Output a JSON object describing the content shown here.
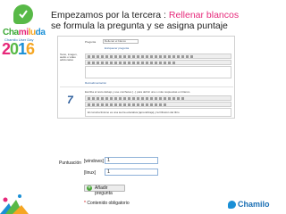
{
  "heading": {
    "prefix": "Empezamos por la tercera : ",
    "highlight": "Rellenar blancos",
    "line2": "se formula la pregunta y se asigna puntaje"
  },
  "brand": {
    "logo_parts": [
      "Cha",
      "mi",
      "lu",
      "da"
    ],
    "subtitle": "Chamilo User Day",
    "year_parts": [
      "2",
      "0",
      "1",
      "6"
    ]
  },
  "shot1": {
    "pregunta_label": "Pregunta",
    "pregunta_value": "Rellenar el blanco",
    "enriquecer_link": "Enriquecer pregunta",
    "texto_label": "Texto, imagen, audio o video adicionales",
    "feedback_link": "Retroalimentación",
    "instructions": "Escriba el texto debajo y use corchetes [...] para definir una o más respuestas en blanco.",
    "answer_text": "El constructivismo es una teoría educativa [aprendizaje] y la Difusión del libro",
    "arrow_glyph": "7"
  },
  "shot2": {
    "puntuacion_label": "Puntuación",
    "windows_label": "[windows]",
    "windows_value": "1",
    "linux_label": "[linux]",
    "linux_value": "1",
    "add_button": "Añadir pregunta",
    "required_star": "*",
    "required_text": " Contenido obligatorio"
  },
  "footer": {
    "logo_text": "Chamilo"
  }
}
